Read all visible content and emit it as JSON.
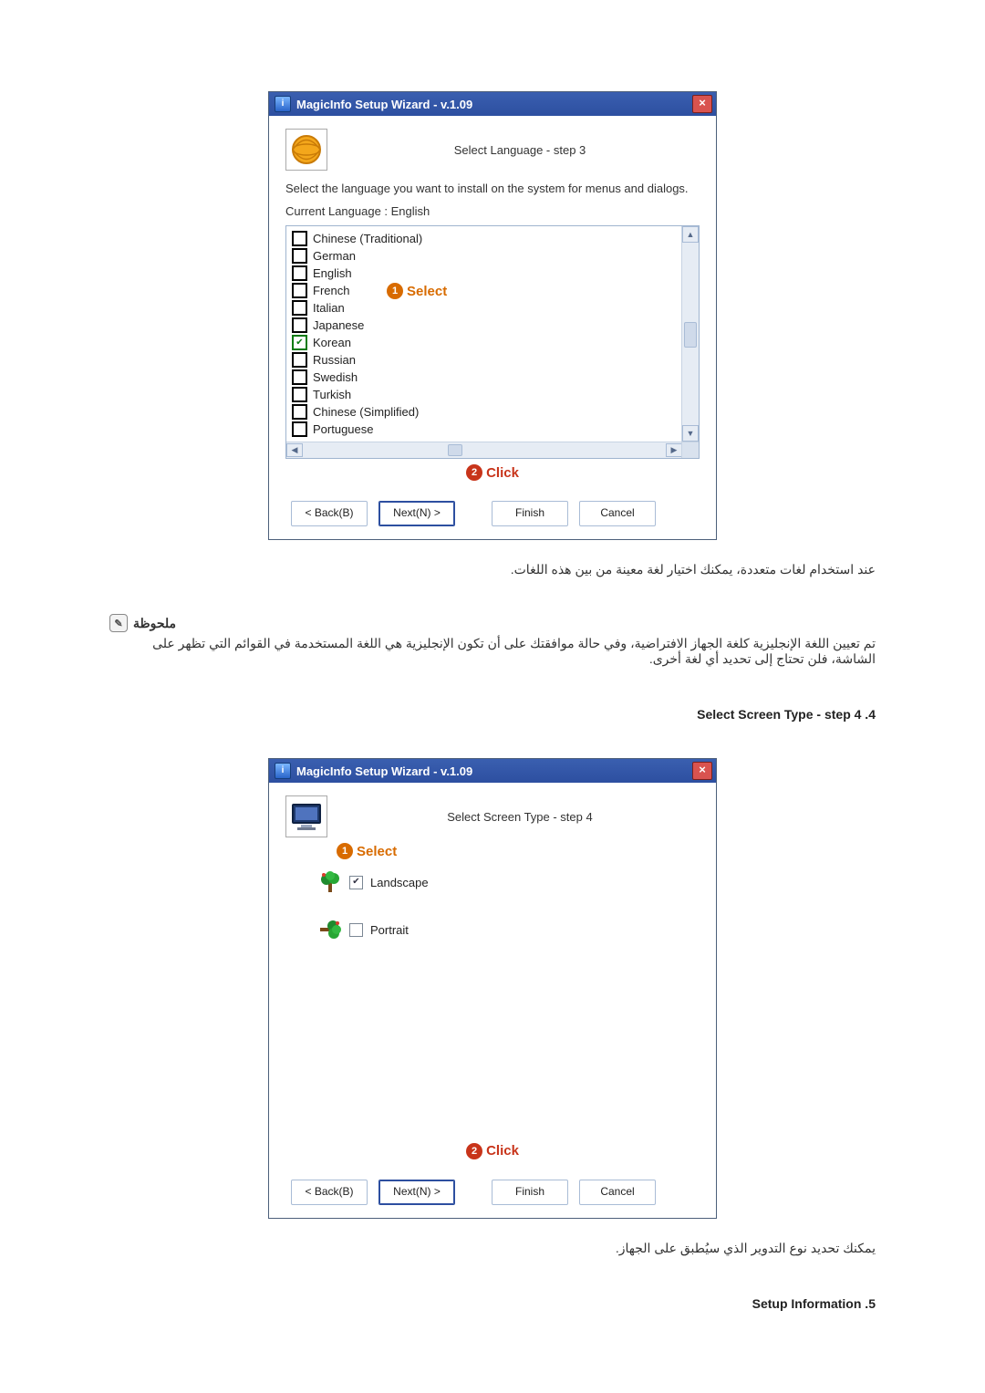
{
  "dialog1": {
    "title": "MagicInfo Setup Wizard - v.1.09",
    "step_title": "Select Language - step 3",
    "desc": "Select the language you want to install on the system for menus and dialogs.",
    "current_lang_label": "Current Language   :    English",
    "select_label": "Select",
    "click_label": "Click",
    "languages": [
      {
        "label": "Chinese (Traditional)",
        "checked": false
      },
      {
        "label": "German",
        "checked": false
      },
      {
        "label": "English",
        "checked": false
      },
      {
        "label": "French",
        "checked": false
      },
      {
        "label": "Italian",
        "checked": false
      },
      {
        "label": "Japanese",
        "checked": false
      },
      {
        "label": "Korean",
        "checked": true
      },
      {
        "label": "Russian",
        "checked": false
      },
      {
        "label": "Swedish",
        "checked": false
      },
      {
        "label": "Turkish",
        "checked": false
      },
      {
        "label": "Chinese (Simplified)",
        "checked": false
      },
      {
        "label": "Portuguese",
        "checked": false
      }
    ],
    "buttons": {
      "back": "< Back(B)",
      "next": "Next(N) >",
      "finish": "Finish",
      "cancel": "Cancel"
    }
  },
  "body_text1": "عند استخدام لغات متعددة، يمكنك اختيار لغة معينة من بين هذه اللغات.",
  "note": {
    "title": "ملحوظة",
    "body": "تم تعيين اللغة الإنجليزية كلغة الجهاز الافتراضية، وفي حالة موافقتك على أن تكون الإنجليزية هي اللغة المستخدمة في القوائم التي تظهر على الشاشة، فلن تحتاج إلى تحديد أي لغة أخرى."
  },
  "section4_title": "4. Select Screen Type - step 4",
  "dialog2": {
    "title": "MagicInfo Setup Wizard - v.1.09",
    "step_title": "Select Screen Type - step 4",
    "select_label": "Select",
    "click_label": "Click",
    "options": {
      "landscape": "Landscape",
      "portrait": "Portrait"
    },
    "buttons": {
      "back": "< Back(B)",
      "next": "Next(N) >",
      "finish": "Finish",
      "cancel": "Cancel"
    }
  },
  "body_text2": "يمكنك تحديد نوع التدوير الذي سيُطبق على الجهاز.",
  "section5_title": "5. Setup Information"
}
